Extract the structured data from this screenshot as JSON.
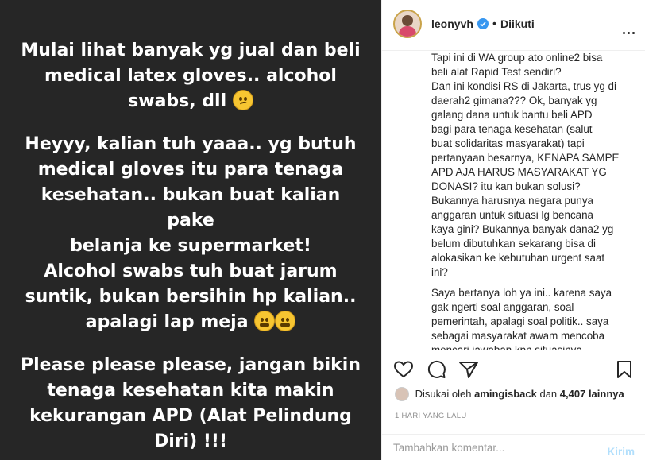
{
  "story": {
    "paragraphs": [
      {
        "lines": [
          "Mulai lihat banyak yg jual dan beli",
          "medical latex gloves.. alcohol",
          "swabs, dll"
        ]
      },
      {
        "lines": [
          "Heyyy, kalian tuh yaaa.. yg butuh",
          "medical gloves itu para tenaga",
          "kesehatan.. bukan buat kalian pake",
          "belanja ke supermarket!",
          "Alcohol swabs tuh buat jarum",
          "suntik, bukan bersihin hp kalian..",
          "apalagi lap meja"
        ]
      },
      {
        "lines": [
          "Please please please, jangan bikin",
          "tenaga kesehatan kita makin",
          "kekurangan APD (Alat Pelindung",
          "Diri) !!!"
        ]
      }
    ],
    "background": "#262626"
  },
  "header": {
    "username": "leonyvh",
    "dot": "•",
    "follow_status": "Diikuti"
  },
  "caption": {
    "lines": [
      "Tapi ini di WA group ato online2 bisa",
      "beli alat Rapid Test sendiri?",
      "Dan ini kondisi RS di Jakarta, trus yg di",
      "daerah2 gimana??? Ok, banyak yg",
      "galang dana untuk bantu beli APD",
      "bagi para tenaga kesehatan (salut",
      "buat solidaritas masyarakat) tapi",
      "pertanyaan besarnya, KENAPA SAMPE",
      "APD AJA HARUS MASYARAKAT YG",
      "DONASI? itu kan bukan solusi?",
      "Bukannya harusnya negara punya",
      "anggaran untuk situasi lg bencana",
      "kaya gini? Bukannya banyak dana2 yg",
      "belum dibutuhkan sekarang bisa di",
      "alokasikan ke kebutuhan urgent saat",
      "ini?",
      "",
      "Saya bertanya loh ya ini.. karena saya",
      "gak ngerti soal anggaran, soal",
      "pemerintah, apalagi soal politik.. saya",
      "sebagai masyarakat awam mencoba",
      "mencari jawaban kpn situasinya"
    ]
  },
  "likes": {
    "prefix": "Disukai oleh",
    "user": "amingisback",
    "conjunction": "dan",
    "count": "4,407 lainnya"
  },
  "time": "1 HARI YANG LALU",
  "comment": {
    "placeholder": "Tambahkan komentar...",
    "post_label": "Kirim"
  },
  "colors": {
    "verified": "#3897f0",
    "post_button": "#b2dffc"
  }
}
